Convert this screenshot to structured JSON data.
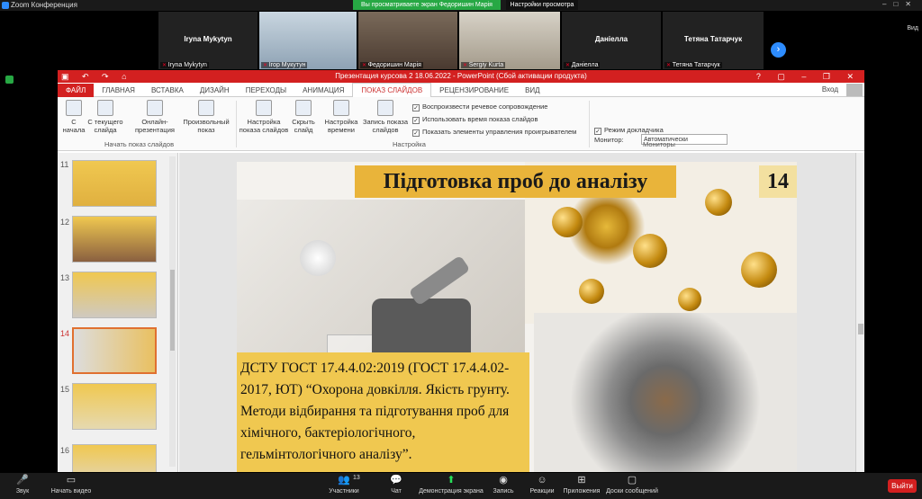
{
  "app": {
    "title": "Zoom Конференция",
    "share_banner": "Вы просматриваете экран Федоришин Марія",
    "view_options": "Настройки просмотра",
    "view_label": "Вид"
  },
  "participants": [
    {
      "name": "Iryna Mykytyn",
      "label": "Iryna Mykytyn"
    },
    {
      "name": "",
      "label": "Ігор Мукутун"
    },
    {
      "name": "",
      "label": "Федоришин Марія"
    },
    {
      "name": "",
      "label": "Sergiy Kurta"
    },
    {
      "name": "Даніелла",
      "label": "Даніелла"
    },
    {
      "name": "Тетяна Татарчук",
      "label": "Тетяна Татарчук"
    }
  ],
  "ppt": {
    "window_title": "Презентация курсова 2 18.06.2022 - PowerPoint (Сбой активации продукта)",
    "tabs": [
      "ФАЙЛ",
      "ГЛАВНАЯ",
      "ВСТАВКА",
      "ДИЗАЙН",
      "ПЕРЕХОДЫ",
      "АНИМАЦИЯ",
      "ПОКАЗ СЛАЙДОВ",
      "РЕЦЕНЗИРОВАНИЕ",
      "ВИД"
    ],
    "login": "Вход",
    "ribbon": {
      "from_start": "С\nначала",
      "from_current": "С текущего\nслайда",
      "online": "Онлайн-\nпрезентация",
      "custom": "Произвольный\nпоказ",
      "group1": "Начать показ слайдов",
      "setup": "Настройка\nпоказа слайдов",
      "hide": "Скрыть\nслайд",
      "rehearse": "Настройка\nвремени",
      "record": "Запись показа\nслайдов",
      "chk1": "Воспроизвести речевое сопровождение",
      "chk2": "Использовать время показа слайдов",
      "chk3": "Показать элементы управления проигрывателем",
      "group2": "Настройка",
      "monitor_label": "Монитор:",
      "monitor_value": "Автоматически",
      "presenter": "Режим докладчика",
      "group3": "Мониторы"
    },
    "thumbs": [
      "11",
      "12",
      "13",
      "14",
      "15",
      "16"
    ]
  },
  "slide": {
    "title": "Підготовка проб до аналізу",
    "number": "14",
    "text": "ДСТУ ГОСТ  17.4.4.02:2019 (ГОСТ 17.4.4.02-2017,  ЮТ) “Охорона  довкілля. Якість  грунту. Методи  відбирання  та підготування  проб для  хімічного, бактеріологічного,  гельмінтологічного аналізу”."
  },
  "zoom_bar": {
    "audio": "Звук",
    "video": "Начать видео",
    "participants": "Участники",
    "participants_count": "13",
    "chat": "Чат",
    "share": "Демонстрация экрана",
    "record": "Запись",
    "reactions": "Реакции",
    "apps": "Приложения",
    "whiteboard": "Доски сообщений",
    "leave": "Выйти"
  }
}
